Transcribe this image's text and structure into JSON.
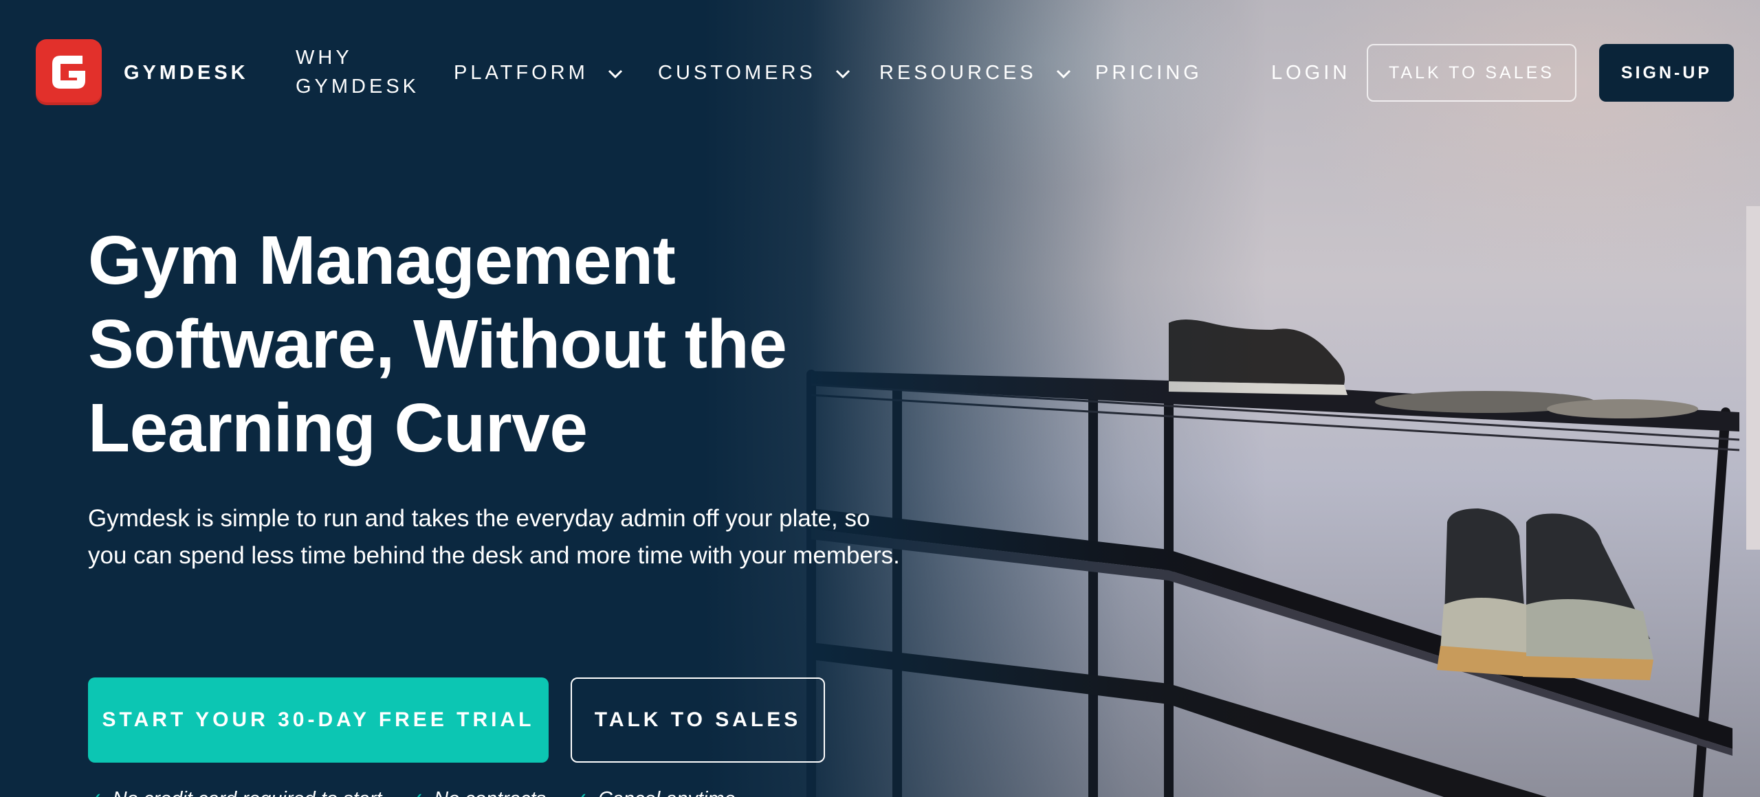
{
  "brand": {
    "name": "GYMDESK",
    "logo_letter": "G"
  },
  "nav": {
    "links": [
      {
        "label": "WHY GYMDESK"
      },
      {
        "label": "PLATFORM"
      },
      {
        "label": "CUSTOMERS"
      },
      {
        "label": "RESOURCES"
      },
      {
        "label": "PRICING"
      }
    ],
    "login": "LOGIN",
    "talk_to_sales": "TALK TO SALES",
    "signup": "SIGN-UP"
  },
  "hero": {
    "headline": "Gym Management Software, Without the Learning Curve",
    "subheadline": "Gymdesk is simple to run and takes the everyday admin off your plate, so you can spend less time behind the desk and more time with your members.",
    "primary_cta": "START YOUR 30-DAY FREE TRIAL",
    "secondary_cta": "TALK TO SALES",
    "bullets": [
      "No credit card required to start",
      "No contracts",
      "Cancel anytime"
    ]
  },
  "colors": {
    "background": "#0b2840",
    "accent": "#0cc6b3",
    "logo": "#e2302b"
  }
}
